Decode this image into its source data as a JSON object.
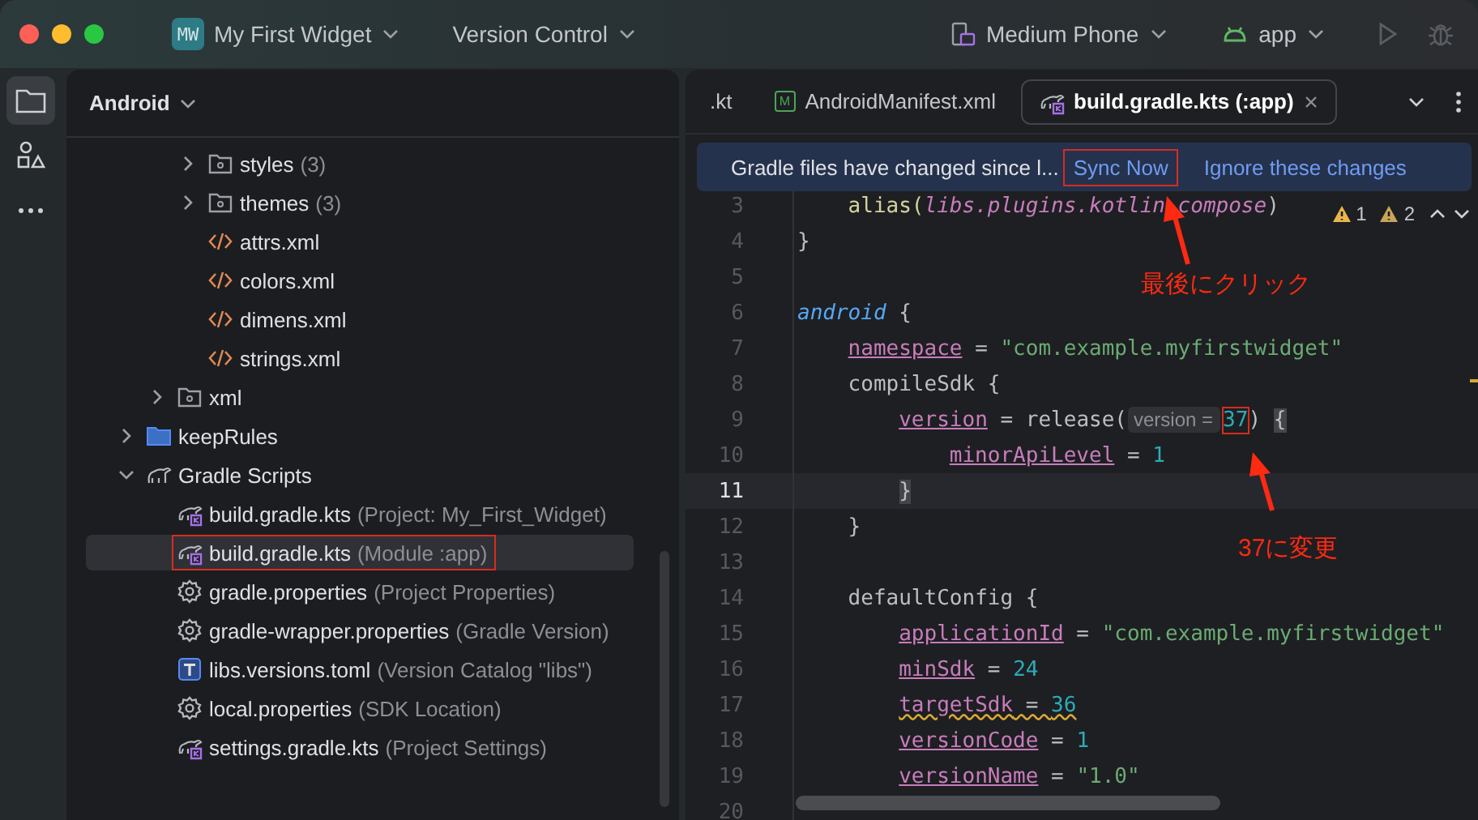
{
  "titlebar": {
    "project_badge": "MW",
    "project": "My First Widget",
    "vcs": "Version Control",
    "device": "Medium Phone",
    "run_config": "app"
  },
  "project_panel": {
    "view": "Android",
    "tree": [
      {
        "children": [
          {
            "children": [
              {
                "label": "styles",
                "detail": "(3)",
                "kind": "res-folder",
                "expanded": false,
                "selected": false,
                "annotated": false
              },
              {
                "label": "themes",
                "detail": "(3)",
                "kind": "res-folder",
                "expanded": false,
                "selected": false,
                "annotated": false
              },
              {
                "label": "attrs.xml",
                "kind": "xml",
                "selected": false,
                "annotated": false
              },
              {
                "label": "colors.xml",
                "kind": "xml",
                "selected": false,
                "annotated": false
              },
              {
                "label": "dimens.xml",
                "kind": "xml",
                "selected": false,
                "annotated": false
              },
              {
                "label": "strings.xml",
                "kind": "xml",
                "selected": false,
                "annotated": false
              }
            ]
          },
          {
            "label": "xml",
            "kind": "res-folder",
            "expanded": false,
            "selected": false,
            "annotated": false
          }
        ]
      },
      {
        "label": "keepRules",
        "kind": "folder",
        "expanded": false,
        "selected": false,
        "annotated": false
      },
      {
        "label": "Gradle Scripts",
        "kind": "gradle-scripts",
        "expanded": true,
        "selected": false,
        "annotated": false,
        "children": [
          {
            "label": "build.gradle.kts",
            "detail": "(Project: My_First_Widget)",
            "kind": "gradle",
            "selected": false,
            "annotated": false
          },
          {
            "label": "build.gradle.kts",
            "detail": "(Module :app)",
            "kind": "gradle",
            "selected": true,
            "annotated": true
          },
          {
            "label": "gradle.properties",
            "detail": "(Project Properties)",
            "kind": "settings",
            "selected": false,
            "annotated": false
          },
          {
            "label": "gradle-wrapper.properties",
            "detail": "(Gradle Version)",
            "kind": "settings",
            "selected": false,
            "annotated": false
          },
          {
            "label": "libs.versions.toml",
            "detail": "(Version Catalog \"libs\")",
            "kind": "toml",
            "selected": false,
            "annotated": false
          },
          {
            "label": "local.properties",
            "detail": "(SDK Location)",
            "kind": "settings",
            "selected": false,
            "annotated": false
          },
          {
            "label": "settings.gradle.kts",
            "detail": "(Project Settings)",
            "kind": "gradle",
            "selected": false,
            "annotated": false
          }
        ]
      }
    ]
  },
  "editor": {
    "tabs": [
      {
        "label": ".kt",
        "kind": "plain",
        "selected": false,
        "closable": false
      },
      {
        "label": "AndroidManifest.xml",
        "kind": "manifest",
        "badge": "M",
        "selected": false,
        "closable": false
      },
      {
        "label": "build.gradle.kts (:app)",
        "kind": "gradle",
        "selected": true,
        "closable": true
      }
    ],
    "banner": {
      "message": "Gradle files have changed since l...",
      "actions": [
        {
          "label": "Sync Now",
          "annotated": true
        },
        {
          "label": "Ignore these changes",
          "annotated": false
        }
      ]
    },
    "inspections": {
      "warnings": "1",
      "weak_warnings": "2"
    },
    "lines": [
      {
        "children": [
          {
            "number": "3",
            "current": false,
            "tokens": [
              {
                "kind": "call",
                "text": "alias("
              },
              {
                "kind": "ext",
                "text": "libs.plugins.kotlin.compose"
              },
              {
                "kind": "plain",
                "text": ")"
              }
            ]
          }
        ]
      },
      {
        "number": "4",
        "current": false,
        "tokens": [
          {
            "kind": "plain",
            "text": "}"
          }
        ]
      },
      {
        "number": "5",
        "current": false
      },
      {
        "number": "6",
        "current": false,
        "tokens": [
          {
            "kind": "keyword",
            "text": "android"
          },
          {
            "kind": "plain",
            "text": " {"
          }
        ],
        "children": [
          {
            "number": "7",
            "current": false,
            "tokens": [
              {
                "kind": "prop",
                "text": "namespace"
              },
              {
                "kind": "plain",
                "text": " = "
              },
              {
                "kind": "str",
                "text": "\"com.example.myfirstwidget\""
              }
            ]
          },
          {
            "number": "8",
            "current": false,
            "tokens": [
              {
                "kind": "plain",
                "text": "compileSdk {"
              }
            ],
            "children": [
              {
                "number": "9",
                "current": false,
                "tokens": [
                  {
                    "kind": "prop",
                    "text": "version"
                  },
                  {
                    "kind": "plain",
                    "text": " = release("
                  },
                  {
                    "kind": "hint",
                    "text": "version ="
                  },
                  {
                    "kind": "num",
                    "text": "37",
                    "annotated": true
                  },
                  {
                    "kind": "plain",
                    "text": ") "
                  },
                  {
                    "kind": "brace",
                    "text": "{"
                  }
                ],
                "children": [
                  {
                    "number": "10",
                    "current": false,
                    "tokens": [
                      {
                        "kind": "prop",
                        "text": "minorApiLevel"
                      },
                      {
                        "kind": "plain",
                        "text": " = "
                      },
                      {
                        "kind": "num",
                        "text": "1"
                      }
                    ]
                  }
                ]
              },
              {
                "number": "11",
                "current": true,
                "tokens": [
                  {
                    "kind": "brace",
                    "text": "}"
                  }
                ]
              }
            ]
          },
          {
            "number": "12",
            "current": false,
            "tokens": [
              {
                "kind": "plain",
                "text": "}"
              }
            ]
          },
          {
            "number": "13",
            "current": false
          },
          {
            "number": "14",
            "current": false,
            "tokens": [
              {
                "kind": "plain",
                "text": "defaultConfig {"
              }
            ],
            "children": [
              {
                "number": "15",
                "current": false,
                "tokens": [
                  {
                    "kind": "prop",
                    "text": "applicationId"
                  },
                  {
                    "kind": "plain",
                    "text": " = "
                  },
                  {
                    "kind": "str",
                    "text": "\"com.example.myfirstwidget\""
                  }
                ]
              },
              {
                "number": "16",
                "current": false,
                "tokens": [
                  {
                    "kind": "prop",
                    "text": "minSdk"
                  },
                  {
                    "kind": "plain",
                    "text": " = "
                  },
                  {
                    "kind": "num",
                    "text": "24"
                  }
                ]
              },
              {
                "number": "17",
                "current": false,
                "tokens": [
                  {
                    "kind": "prop",
                    "text": "targetSdk",
                    "warning": true
                  },
                  {
                    "kind": "plain",
                    "text": " = ",
                    "warning": true
                  },
                  {
                    "kind": "num",
                    "text": "36",
                    "warning": true
                  }
                ]
              },
              {
                "number": "18",
                "current": false,
                "tokens": [
                  {
                    "kind": "prop",
                    "text": "versionCode"
                  },
                  {
                    "kind": "plain",
                    "text": " = "
                  },
                  {
                    "kind": "num",
                    "text": "1"
                  }
                ]
              },
              {
                "number": "19",
                "current": false,
                "tokens": [
                  {
                    "kind": "prop",
                    "text": "versionName"
                  },
                  {
                    "kind": "plain",
                    "text": " = "
                  },
                  {
                    "kind": "str",
                    "text": "\"1.0\""
                  }
                ]
              }
            ]
          },
          {
            "number": "20",
            "current": false
          }
        ]
      }
    ]
  },
  "annotations": [
    {
      "text": "最後にクリック",
      "kind": "click-note"
    },
    {
      "text": "37に変更",
      "kind": "change-note"
    }
  ]
}
